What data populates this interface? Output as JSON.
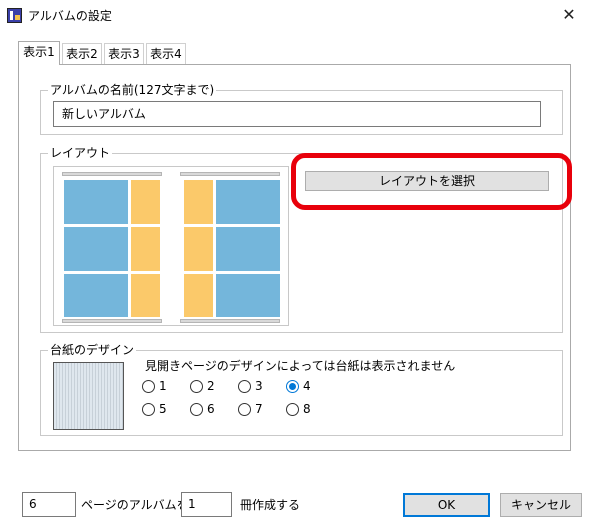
{
  "window": {
    "title": "アルバムの設定",
    "close_glyph": "✕",
    "app_icon": "album-app-icon"
  },
  "tabs": [
    {
      "label": "表示1",
      "selected": true
    },
    {
      "label": "表示2",
      "selected": false
    },
    {
      "label": "表示3",
      "selected": false
    },
    {
      "label": "表示4",
      "selected": false
    }
  ],
  "album_name": {
    "legend": "アルバムの名前(127文字まで)",
    "value": "新しいアルバム"
  },
  "layout": {
    "legend": "レイアウト",
    "select_button": "レイアウトを選択",
    "highlight_color": "#e8000b",
    "photo_color": "#74b6db",
    "text_color": "#fbc96a"
  },
  "paper": {
    "legend": "台紙のデザイン",
    "note": "見開きページのデザインによっては台紙は表示されません",
    "options": [
      "1",
      "2",
      "3",
      "4",
      "5",
      "6",
      "7",
      "8"
    ],
    "selected": "4"
  },
  "footer": {
    "pages_value": "6",
    "pages_label": "ページのアルバムを",
    "count_value": "1",
    "count_label": "冊作成する",
    "ok": "OK",
    "cancel": "キャンセル"
  }
}
